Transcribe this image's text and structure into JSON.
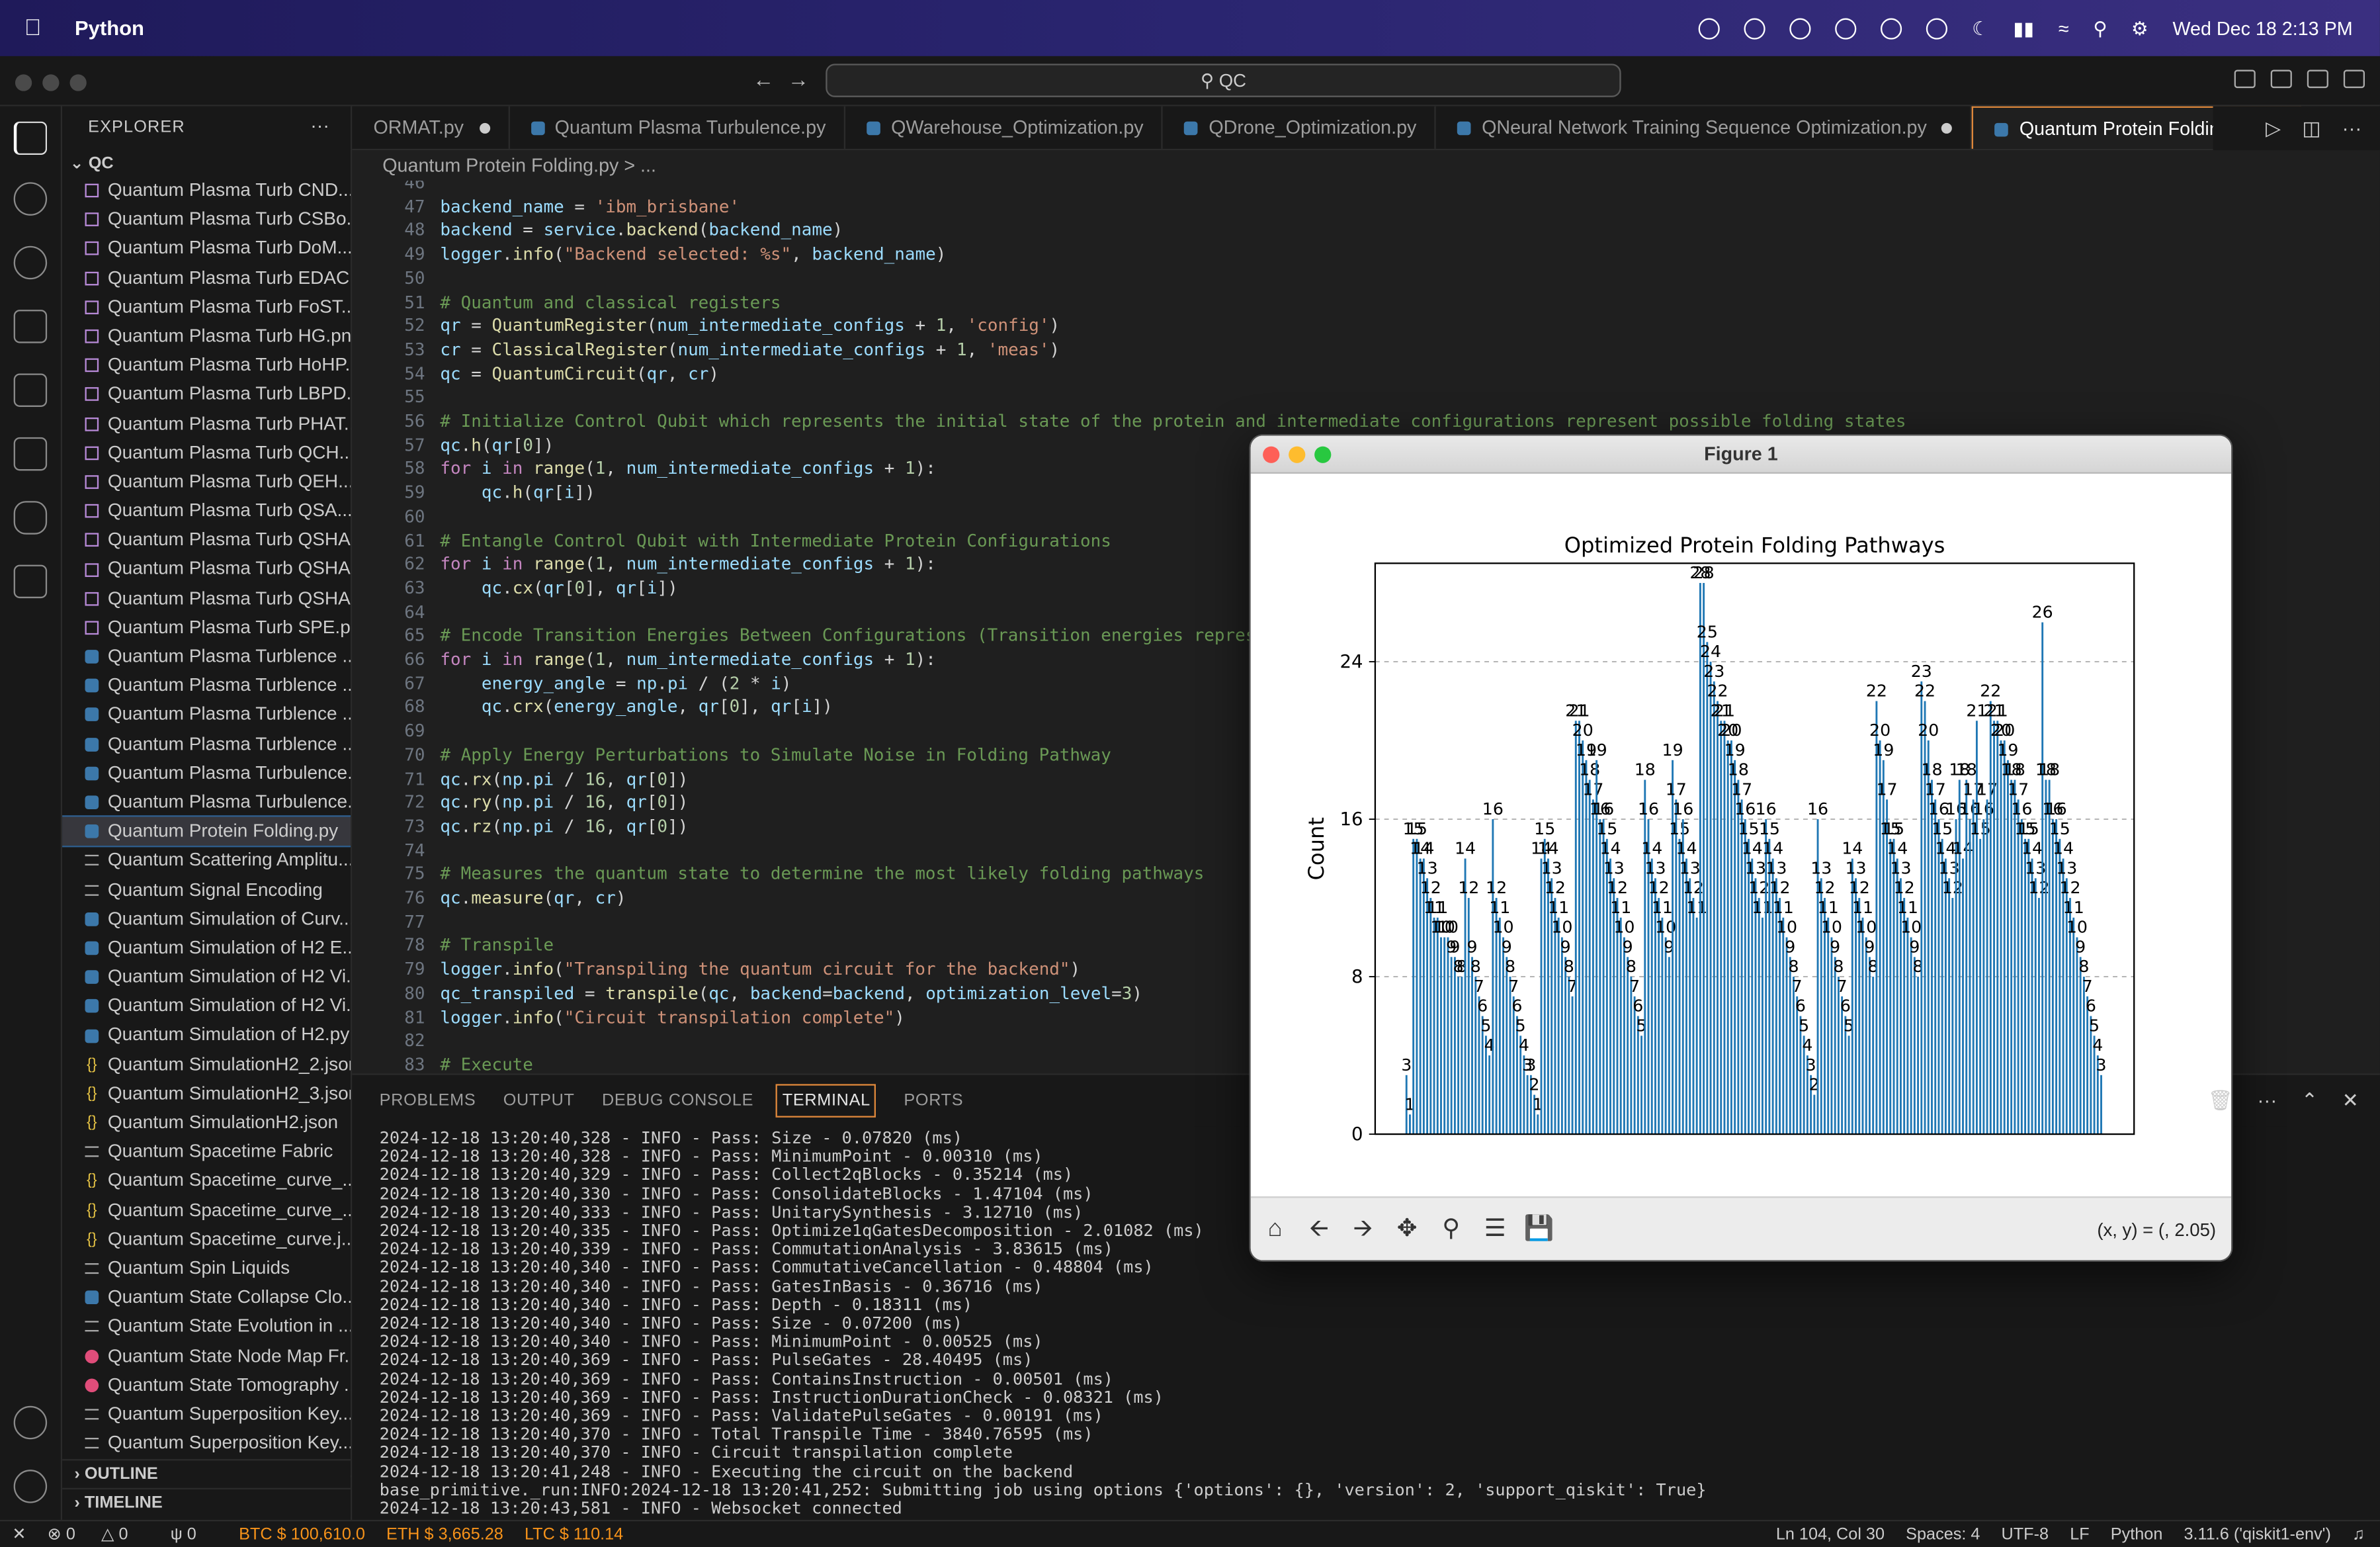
{
  "menubar": {
    "app": "Python",
    "datetime": "Wed Dec 18  2:13 PM"
  },
  "window": {
    "search": "QC"
  },
  "explorer": {
    "title": "EXPLORER",
    "root": "QC",
    "outline": "OUTLINE",
    "timeline": "TIMELINE",
    "files": [
      {
        "name": "Quantum Plasma Turb CND...",
        "type": "png"
      },
      {
        "name": "Quantum Plasma Turb CSBo...",
        "type": "png"
      },
      {
        "name": "Quantum Plasma Turb DoM...",
        "type": "png"
      },
      {
        "name": "Quantum Plasma Turb EDAC...",
        "type": "png"
      },
      {
        "name": "Quantum Plasma Turb FoST...",
        "type": "png"
      },
      {
        "name": "Quantum Plasma Turb HG.png",
        "type": "png"
      },
      {
        "name": "Quantum Plasma Turb HoHP...",
        "type": "png"
      },
      {
        "name": "Quantum Plasma Turb LBPD...",
        "type": "png"
      },
      {
        "name": "Quantum Plasma Turb PHAT...",
        "type": "png"
      },
      {
        "name": "Quantum Plasma Turb QCH....",
        "type": "png"
      },
      {
        "name": "Quantum Plasma Turb QEH....",
        "type": "png"
      },
      {
        "name": "Quantum Plasma Turb QSA....",
        "type": "png"
      },
      {
        "name": "Quantum Plasma Turb QSHA...",
        "type": "png"
      },
      {
        "name": "Quantum Plasma Turb QSHA...",
        "type": "png"
      },
      {
        "name": "Quantum Plasma Turb QSHA...",
        "type": "png"
      },
      {
        "name": "Quantum Plasma Turb SPE.p...",
        "type": "png"
      },
      {
        "name": "Quantum Plasma Turblence ...",
        "type": "py"
      },
      {
        "name": "Quantum Plasma Turblence ...",
        "type": "py"
      },
      {
        "name": "Quantum Plasma Turblence ...",
        "type": "py"
      },
      {
        "name": "Quantum Plasma Turblence ...",
        "type": "py"
      },
      {
        "name": "Quantum Plasma Turbulence...",
        "type": "py"
      },
      {
        "name": "Quantum Plasma Turbulence...",
        "type": "py"
      },
      {
        "name": "Quantum Protein Folding.py",
        "type": "py",
        "active": true
      },
      {
        "name": "Quantum Scattering Amplitu...",
        "type": "txt"
      },
      {
        "name": "Quantum Signal Encoding",
        "type": "txt"
      },
      {
        "name": "Quantum Simulation of Curv...",
        "type": "py"
      },
      {
        "name": "Quantum Simulation of H2 E...",
        "type": "py"
      },
      {
        "name": "Quantum Simulation of H2 Vi...",
        "type": "py"
      },
      {
        "name": "Quantum Simulation of H2 Vi...",
        "type": "py"
      },
      {
        "name": "Quantum Simulation of H2.py",
        "type": "py"
      },
      {
        "name": "Quantum SimulationH2_2.json",
        "type": "json"
      },
      {
        "name": "Quantum SimulationH2_3.json",
        "type": "json"
      },
      {
        "name": "Quantum SimulationH2.json",
        "type": "json"
      },
      {
        "name": "Quantum Spacetime Fabric",
        "type": "txt"
      },
      {
        "name": "Quantum Spacetime_curve_...",
        "type": "json"
      },
      {
        "name": "Quantum Spacetime_curve_...",
        "type": "json"
      },
      {
        "name": "Quantum Spacetime_curve.j...",
        "type": "json"
      },
      {
        "name": "Quantum Spin Liquids",
        "type": "txt"
      },
      {
        "name": "Quantum State Collapse Clo...",
        "type": "py"
      },
      {
        "name": "Quantum State Evolution in ...",
        "type": "txt"
      },
      {
        "name": "Quantum State Node Map Fr...",
        "type": "red"
      },
      {
        "name": "Quantum State Tomography ...",
        "type": "red"
      },
      {
        "name": "Quantum Superposition Key...",
        "type": "txt"
      },
      {
        "name": "Quantum Superposition Key...",
        "type": "txt"
      },
      {
        "name": "Quantum Superposition Key...",
        "type": "txt"
      }
    ]
  },
  "tabs": [
    {
      "label": "ORMAT.py",
      "dirty": true
    },
    {
      "label": "Quantum Plasma Turbulence.py",
      "dirty": false
    },
    {
      "label": "QWarehouse_Optimization.py",
      "dirty": false
    },
    {
      "label": "QDrone_Optimization.py",
      "dirty": false
    },
    {
      "label": "QNeural Network Training Sequence Optimization.py",
      "dirty": true
    },
    {
      "label": "Quantum Protein Folding.py",
      "dirty": true,
      "active": true
    }
  ],
  "breadcrumb": "Quantum Protein Folding.py > ...",
  "code": [
    {
      "n": "46",
      "t": ""
    },
    {
      "n": "47",
      "t": "backend_name = 'ibm_brisbane'"
    },
    {
      "n": "48",
      "t": "backend = service.backend(backend_name)"
    },
    {
      "n": "49",
      "t": "logger.info(\"Backend selected: %s\", backend_name)"
    },
    {
      "n": "50",
      "t": ""
    },
    {
      "n": "51",
      "t": "# Quantum and classical registers"
    },
    {
      "n": "52",
      "t": "qr = QuantumRegister(num_intermediate_configs + 1, 'config')"
    },
    {
      "n": "53",
      "t": "cr = ClassicalRegister(num_intermediate_configs + 1, 'meas')"
    },
    {
      "n": "54",
      "t": "qc = QuantumCircuit(qr, cr)"
    },
    {
      "n": "55",
      "t": ""
    },
    {
      "n": "56",
      "t": "# Initialize Control Qubit which represents the initial state of the protein and intermediate configurations represent possible folding states"
    },
    {
      "n": "57",
      "t": "qc.h(qr[0])"
    },
    {
      "n": "58",
      "t": "for i in range(1, num_intermediate_configs + 1):"
    },
    {
      "n": "59",
      "t": "    qc.h(qr[i])"
    },
    {
      "n": "60",
      "t": ""
    },
    {
      "n": "61",
      "t": "# Entangle Control Qubit with Intermediate Protein Configurations"
    },
    {
      "n": "62",
      "t": "for i in range(1, num_intermediate_configs + 1):"
    },
    {
      "n": "63",
      "t": "    qc.cx(qr[0], qr[i])"
    },
    {
      "n": "64",
      "t": ""
    },
    {
      "n": "65",
      "t": "# Encode Transition Energies Between Configurations (Transition energies represent th"
    },
    {
      "n": "66",
      "t": "for i in range(1, num_intermediate_configs + 1):"
    },
    {
      "n": "67",
      "t": "    energy_angle = np.pi / (2 * i)"
    },
    {
      "n": "68",
      "t": "    qc.crx(energy_angle, qr[0], qr[i])"
    },
    {
      "n": "69",
      "t": ""
    },
    {
      "n": "70",
      "t": "# Apply Energy Perturbations to Simulate Noise in Folding Pathway"
    },
    {
      "n": "71",
      "t": "qc.rx(np.pi / 16, qr[0])"
    },
    {
      "n": "72",
      "t": "qc.ry(np.pi / 16, qr[0])"
    },
    {
      "n": "73",
      "t": "qc.rz(np.pi / 16, qr[0])"
    },
    {
      "n": "74",
      "t": ""
    },
    {
      "n": "75",
      "t": "# Measures the quantum state to determine the most likely folding pathways"
    },
    {
      "n": "76",
      "t": "qc.measure(qr, cr)"
    },
    {
      "n": "77",
      "t": ""
    },
    {
      "n": "78",
      "t": "# Transpile"
    },
    {
      "n": "79",
      "t": "logger.info(\"Transpiling the quantum circuit for the backend\")"
    },
    {
      "n": "80",
      "t": "qc_transpiled = transpile(qc, backend=backend, optimization_level=3)"
    },
    {
      "n": "81",
      "t": "logger.info(\"Circuit transpilation complete\")"
    },
    {
      "n": "82",
      "t": ""
    },
    {
      "n": "83",
      "t": "# Execute"
    }
  ],
  "panel": {
    "tabs": [
      "PROBLEMS",
      "OUTPUT",
      "DEBUG CONSOLE",
      "TERMINAL",
      "PORTS"
    ],
    "active": "TERMINAL"
  },
  "terminal": [
    "2024-12-18 13:20:40,328 - INFO - Pass: Size - 0.07820 (ms)",
    "2024-12-18 13:20:40,328 - INFO - Pass: MinimumPoint - 0.00310 (ms)",
    "2024-12-18 13:20:40,329 - INFO - Pass: Collect2qBlocks - 0.35214 (ms)",
    "2024-12-18 13:20:40,330 - INFO - Pass: ConsolidateBlocks - 1.47104 (ms)",
    "2024-12-18 13:20:40,333 - INFO - Pass: UnitarySynthesis - 3.12710 (ms)",
    "2024-12-18 13:20:40,335 - INFO - Pass: Optimize1qGatesDecomposition - 2.01082 (ms)",
    "2024-12-18 13:20:40,339 - INFO - Pass: CommutationAnalysis - 3.83615 (ms)",
    "2024-12-18 13:20:40,340 - INFO - Pass: CommutativeCancellation - 0.48804 (ms)",
    "2024-12-18 13:20:40,340 - INFO - Pass: GatesInBasis - 0.36716 (ms)",
    "2024-12-18 13:20:40,340 - INFO - Pass: Depth - 0.18311 (ms)",
    "2024-12-18 13:20:40,340 - INFO - Pass: Size - 0.07200 (ms)",
    "2024-12-18 13:20:40,340 - INFO - Pass: MinimumPoint - 0.00525 (ms)",
    "2024-12-18 13:20:40,369 - INFO - Pass: PulseGates - 28.40495 (ms)",
    "2024-12-18 13:20:40,369 - INFO - Pass: ContainsInstruction - 0.00501 (ms)",
    "2024-12-18 13:20:40,369 - INFO - Pass: InstructionDurationCheck - 0.08321 (ms)",
    "2024-12-18 13:20:40,369 - INFO - Pass: ValidatePulseGates - 0.00191 (ms)",
    "2024-12-18 13:20:40,370 - INFO - Total Transpile Time - 3840.76595 (ms)",
    "2024-12-18 13:20:40,370 - INFO - Circuit transpilation complete",
    "2024-12-18 13:20:41,248 - INFO - Executing the circuit on the backend",
    "base_primitive._run:INFO:2024-12-18 13:20:41,252: Submitting job using options {'options': {}, 'version': 2, 'support_qiskit': True}",
    "2024-12-18 13:20:43,581 - INFO - Websocket connected"
  ],
  "status": {
    "errors": "0",
    "warnings": "0",
    "ports": "0",
    "btc": "BTC $ 100,610.0",
    "eth": "ETH $ 3,665.28",
    "ltc": "LTC $ 110.14",
    "position": "Ln 104, Col 30",
    "spaces": "Spaces: 4",
    "encoding": "UTF-8",
    "eol": "LF",
    "language": "Python",
    "interpreter": "3.11.6 ('qiskit1-env')"
  },
  "figure": {
    "window_title": "Figure 1",
    "coords": "(x, y) = (, 2.05)"
  },
  "chart_data": {
    "type": "bar",
    "title": "Optimized Protein Folding Pathways",
    "ylabel": "Count",
    "xlabel": "",
    "ylim": [
      0,
      29
    ],
    "yticks": [
      0,
      8,
      16,
      24
    ],
    "grid": true,
    "color": "#1f77b4",
    "values": [
      3,
      1,
      15,
      15,
      14,
      14,
      13,
      12,
      11,
      11,
      10,
      10,
      10,
      9,
      9,
      8,
      8,
      14,
      12,
      9,
      8,
      7,
      6,
      5,
      4,
      16,
      12,
      11,
      10,
      9,
      8,
      7,
      6,
      5,
      4,
      3,
      3,
      2,
      1,
      14,
      15,
      14,
      13,
      12,
      11,
      10,
      9,
      8,
      7,
      21,
      21,
      20,
      19,
      18,
      17,
      19,
      16,
      16,
      15,
      14,
      13,
      12,
      11,
      10,
      9,
      8,
      7,
      6,
      5,
      18,
      16,
      14,
      13,
      12,
      11,
      10,
      9,
      19,
      17,
      15,
      16,
      14,
      13,
      12,
      11,
      28,
      28,
      25,
      24,
      23,
      22,
      21,
      21,
      20,
      20,
      19,
      18,
      17,
      16,
      15,
      14,
      13,
      12,
      11,
      16,
      15,
      14,
      13,
      12,
      11,
      10,
      9,
      8,
      7,
      6,
      5,
      4,
      3,
      2,
      16,
      13,
      12,
      11,
      10,
      9,
      8,
      7,
      6,
      5,
      14,
      13,
      12,
      11,
      10,
      9,
      8,
      22,
      20,
      19,
      17,
      15,
      15,
      14,
      13,
      12,
      11,
      10,
      9,
      8,
      23,
      22,
      20,
      18,
      17,
      16,
      15,
      14,
      13,
      12,
      16,
      18,
      14,
      18,
      16,
      17,
      21,
      15,
      16,
      17,
      22,
      21,
      21,
      20,
      20,
      19,
      18,
      18,
      17,
      16,
      15,
      15,
      14,
      13,
      12,
      26,
      18,
      18,
      16,
      16,
      15,
      14,
      13,
      12,
      11,
      10,
      9,
      8,
      7,
      6,
      5,
      4,
      3
    ]
  }
}
